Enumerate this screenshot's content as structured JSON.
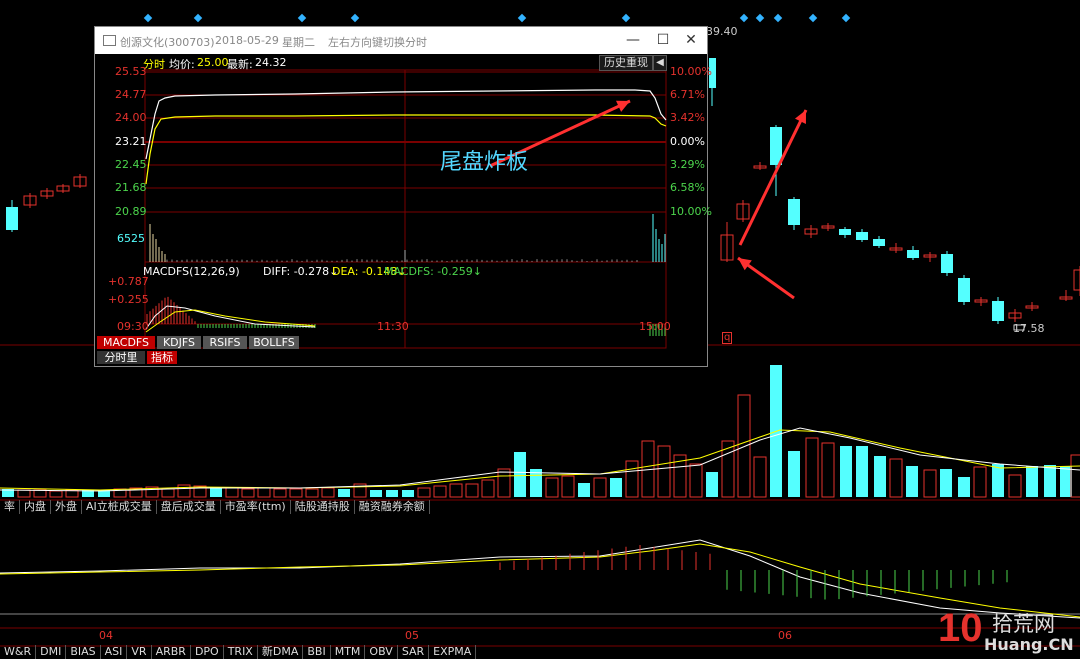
{
  "main_chart": {
    "top_price_label": "39.40",
    "low_price_label": "17.58",
    "q_marker": "q"
  },
  "volume_tabs": [
    "率",
    "内盘",
    "外盘",
    "AI立桩成交量",
    "盘后成交量",
    "市盈率(ttm)",
    "陆股通持股",
    "融资融券余额"
  ],
  "date_axis": [
    "04",
    "05",
    "06"
  ],
  "bottom_tabs": [
    "W&R",
    "DMI",
    "BIAS",
    "ASI",
    "VR",
    "ARBR",
    "DPO",
    "TRIX",
    "新DMA",
    "BBI",
    "MTM",
    "OBV",
    "SAR",
    "EXPMA"
  ],
  "watermark": {
    "mark": "10",
    "text1": "拾荒网",
    "text2": "Huang.CN"
  },
  "popup": {
    "title_stock": "创源文化(300703)",
    "title_date": "2018-05-29",
    "title_weekday": "星期二",
    "title_hint": "左右方向键切换分时",
    "win_min": "—",
    "win_max": "☐",
    "win_close": "✕",
    "header_mode": "分时",
    "header_avg_label": "均价:",
    "header_avg_value": "25.00",
    "header_last_label": "最新:",
    "header_last_value": "24.32",
    "history_button": "历史重现",
    "history_arrow": "◀",
    "price_labels": [
      "25.53",
      "24.77",
      "24.00",
      "23.21",
      "22.45",
      "21.68",
      "20.89"
    ],
    "pct_labels": [
      "10.00%",
      "6.71%",
      "3.42%",
      "0.00%",
      "3.29%",
      "6.58%",
      "10.00%"
    ],
    "volume_label": "6525",
    "annotation": "尾盘炸板",
    "macd_title": "MACDFS(12,26,9)",
    "macd_diff": "DIFF: -0.278↓",
    "macd_dea": "DEA: -0.148↓",
    "macd_macdfs": "MACDFS: -0.259↓",
    "macd_axis": [
      "+0.787",
      "+0.255"
    ],
    "time_labels": [
      "09:30",
      "11:30",
      "15:00"
    ],
    "tabs": [
      "MACDFS",
      "KDJFS",
      "RSIFS",
      "BOLLFS"
    ],
    "bottom_tabs": [
      "分时里",
      "指标"
    ]
  },
  "colors": {
    "up": "#e5322d",
    "down": "#54ffff",
    "ma_white": "#ffffff",
    "ma_yellow": "#ffff00",
    "annotation": "#54d7ff"
  }
}
